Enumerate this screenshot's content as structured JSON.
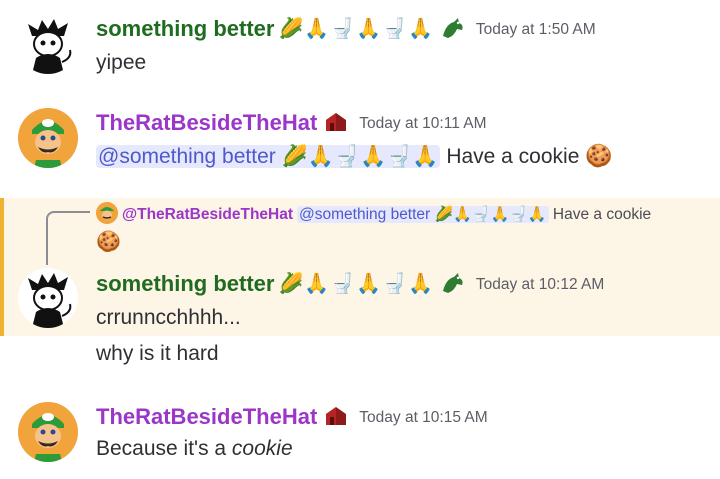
{
  "messages": [
    {
      "author": "something better",
      "author_emojis": "🌽🙏🚽🙏🚽🙏",
      "timestamp": "Today at 1:50 AM",
      "text": "yipee"
    },
    {
      "author": "TheRatBesideTheHat",
      "timestamp": "Today at 10:11 AM",
      "mention": "@something better 🌽🙏🚽🙏🚽🙏",
      "text": "Have a cookie",
      "text_emoji": "🍪"
    },
    {
      "reply": {
        "author": "@TheRatBesideTheHat",
        "mention": "@something better",
        "mention_emojis": "🌽🙏🚽🙏🚽🙏",
        "text": "Have a cookie",
        "text_emoji": "🍪"
      },
      "author": "something better",
      "author_emojis": "🌽🙏🚽🙏🚽🙏",
      "timestamp": "Today at 10:12 AM",
      "text": "crrunncchhhh...",
      "followup": "why is it hard"
    },
    {
      "author": "TheRatBesideTheHat",
      "timestamp": "Today at 10:15 AM",
      "text_prefix": "Because it's a ",
      "text_italic": "cookie"
    }
  ],
  "colors": {
    "green_name": "#1f6b1f",
    "purple_name": "#9b36c9",
    "mention_bg": "#e6e8fd",
    "mention_text": "#4e5acb",
    "highlight_bg": "#fdf5e6",
    "highlight_bar": "#f0b232"
  },
  "icons": [
    "dragon-icon",
    "red-house-icon",
    "luigi-avatar",
    "monochrome-cat-avatar"
  ]
}
